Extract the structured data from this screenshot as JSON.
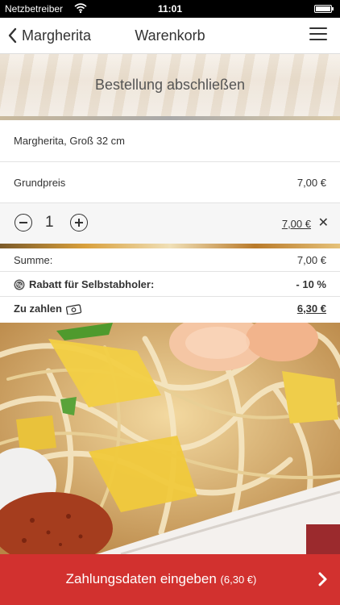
{
  "status_bar": {
    "carrier": "Netzbetreiber",
    "time": "11:01",
    "wifi_icon": "wifi-icon",
    "battery_icon": "battery-icon"
  },
  "nav": {
    "back_label": "Margherita",
    "title": "Warenkorb",
    "menu_icon": "hamburger-menu-icon"
  },
  "banner": {
    "heading": "Bestellung abschließen"
  },
  "cart": {
    "product_name": "Margherita, Groß 32 cm",
    "base_price_label": "Grundpreis",
    "base_price": "7,00 €",
    "quantity": "1",
    "line_total": "7,00 €",
    "remove_symbol": "✕"
  },
  "summary": {
    "sum_label": "Summe:",
    "sum_value": "7,00 €",
    "discount_label": "Rabatt für Selbstabholer:",
    "discount_value": "- 10 %",
    "pay_label": "Zu zahlen",
    "pay_value": "6,30 €"
  },
  "footer": {
    "button_label": "Zahlungsdaten eingeben",
    "button_amount": "(6,30 €)"
  },
  "colors": {
    "accent": "#d2312f",
    "text": "#333333",
    "row_alt": "#f6f6f6"
  }
}
